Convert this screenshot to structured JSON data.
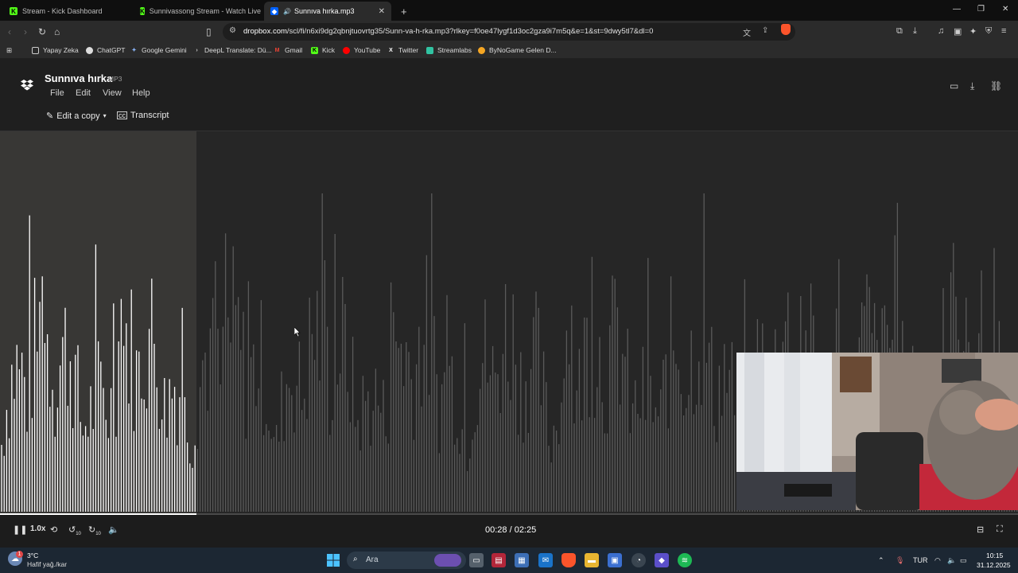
{
  "browser": {
    "tabs": [
      {
        "title": "Stream - Kick Dashboard",
        "favicon": "kick-icon"
      },
      {
        "title": "Sunnivassong Stream - Watch Live o",
        "favicon": "kick-icon"
      },
      {
        "title": "Sunnıva hırka.mp3",
        "favicon": "dropbox-icon",
        "active": true
      }
    ],
    "url_host": "dropbox.com",
    "url_path": "/scl/fi/n6xi9dg2qbnjtuovrtg35/Sunn-va-h-rka.mp3?rlkey=f0oe47lygf1d3oc2gza9i7m5q&e=1&st=9dwy5tl7&dl=0",
    "bookmarks": [
      {
        "label": "Yapay Zeka",
        "icon": "folder-icon"
      },
      {
        "label": "ChatGPT",
        "icon": "chatgpt-icon"
      },
      {
        "label": "Google Gemini",
        "icon": "gemini-icon"
      },
      {
        "label": "DeepL Translate: Dü...",
        "icon": "deepl-icon"
      },
      {
        "label": "Gmail",
        "icon": "gmail-icon"
      },
      {
        "label": "Kick",
        "icon": "kick-icon"
      },
      {
        "label": "YouTube",
        "icon": "youtube-icon"
      },
      {
        "label": "Twitter",
        "icon": "x-icon"
      },
      {
        "label": "Streamlabs",
        "icon": "streamlabs-icon"
      },
      {
        "label": "ByNoGame Gelen D...",
        "icon": "bynogame-icon"
      }
    ]
  },
  "app": {
    "file_name": "Sunnıva hırka",
    "file_type": "MP3",
    "menu": [
      "File",
      "Edit",
      "View",
      "Help"
    ],
    "edit_copy_label": "Edit a copy",
    "transcript_label": "Transcript"
  },
  "player": {
    "speed": "1.0x",
    "skip_back": "10",
    "skip_forward": "10",
    "time_display": "00:28 / 02:25",
    "progress_fraction": 0.193
  },
  "taskbar": {
    "weather_temp": "3°C",
    "weather_desc": "Hafif yağ./kar",
    "weather_badge": "1",
    "search_placeholder": "Ara",
    "language": "TUR",
    "time": "10:15",
    "date": "31.12.2025"
  },
  "colors": {
    "played_wave": "#ffffff",
    "unplayed_wave": "#5a5a5a",
    "played_bg": "#383735",
    "accent_brave": "#fb542b",
    "dropbox_blue": "#0061fe"
  }
}
